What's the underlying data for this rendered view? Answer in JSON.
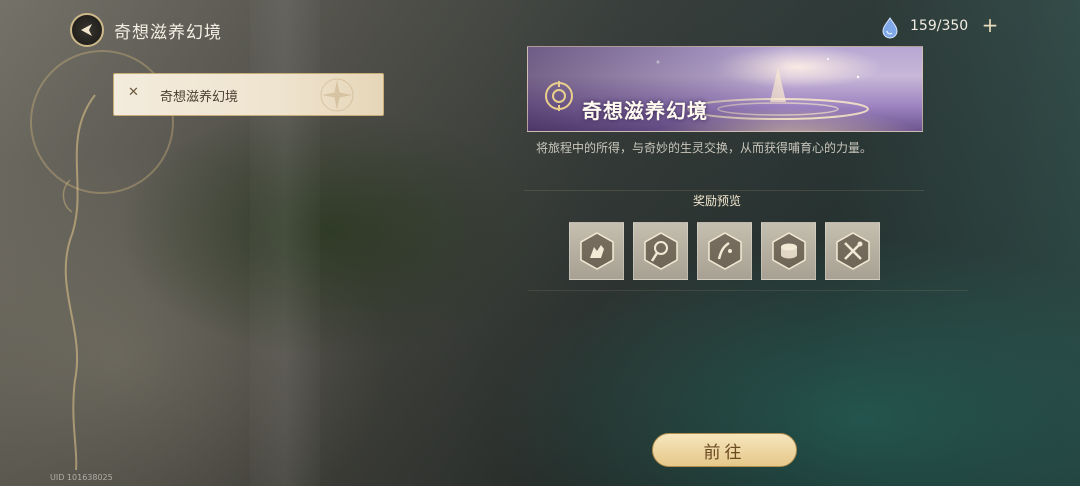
{
  "header": {
    "title": "奇想滋养幻境",
    "back_icon": "back-arrow-icon"
  },
  "sidebar": {
    "items": [
      {
        "label": "奇想滋养幻境",
        "selected": true
      }
    ]
  },
  "currency": {
    "icon": "resin-droplet-icon",
    "value": "159/350",
    "plus_label": "+"
  },
  "banner": {
    "title": "奇想滋养幻境"
  },
  "description": "将旅程中的所得，与奇妙的生灵交换，从而获得哺育心的力量。",
  "rewards": {
    "heading": "奖励预览",
    "items": [
      {
        "icon": "glove-icon"
      },
      {
        "icon": "net-icon"
      },
      {
        "icon": "brush-icon"
      },
      {
        "icon": "drum-icon"
      },
      {
        "icon": "crossed-tools-icon"
      }
    ]
  },
  "go_button": {
    "label": "前往"
  },
  "uid": "UID 101638025",
  "colors": {
    "accent": "#e6c88a",
    "panel_text": "#4a3f30"
  }
}
